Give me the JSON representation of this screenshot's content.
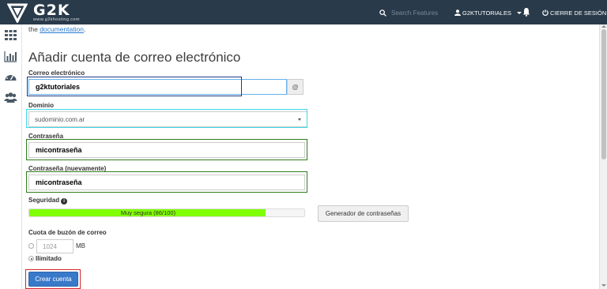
{
  "topbar": {
    "logo_text": "G2K",
    "logo_sub": "www.g2khosting.com",
    "search_placeholder": "Search Features",
    "username": "G2KTUTORIALES",
    "logout_label": "CIERRE DE SESIÓN"
  },
  "sidebar": {
    "items": [
      {
        "icon": "grid-icon"
      },
      {
        "icon": "bar-chart-icon"
      },
      {
        "icon": "dashboard-gauge-icon"
      },
      {
        "icon": "users-icon"
      }
    ]
  },
  "main": {
    "intro_prefix": "the",
    "intro_link": "documentation",
    "intro_suffix": ".",
    "title": "Añadir cuenta de correo electrónico",
    "email": {
      "label": "Correo electrónico",
      "value": "g2ktutoriales",
      "addon": "@"
    },
    "domain": {
      "label": "Dominio",
      "selected": "sudominio.com.ar"
    },
    "password": {
      "label": "Contraseña",
      "value": "micontraseña"
    },
    "password_again": {
      "label": "Contraseña (nuevamente)",
      "value": "micontraseña"
    },
    "strength": {
      "label": "Seguridad",
      "text": "Muy segura (86/100)",
      "value": 86,
      "max": 100,
      "color": "#7fff00"
    },
    "generator_label": "Generador de contraseñas",
    "quota": {
      "label": "Cuota de buzón de correo",
      "value": "1024",
      "unit": "MB",
      "unlimited_label": "Ilimitado",
      "unlimited_selected": true
    },
    "create_label": "Crear cuenta"
  },
  "colors": {
    "topbar": "#293a4a",
    "accent": "#3979c9",
    "highlight_navy": "#1d3a8a",
    "highlight_cyan": "#3fd8e8",
    "highlight_green": "#2f7d1c",
    "highlight_red": "#d6252a"
  }
}
